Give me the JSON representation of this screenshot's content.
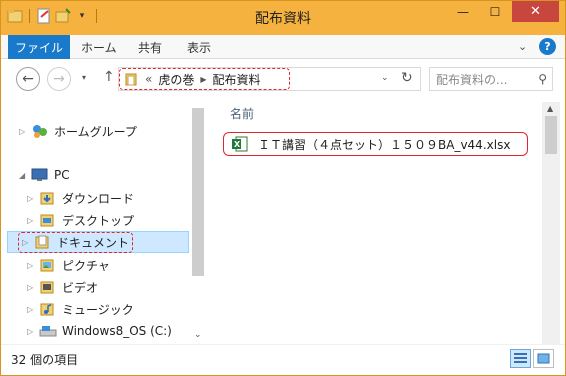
{
  "window": {
    "title": "配布資料"
  },
  "ribbon": {
    "file_tab": "ファイル",
    "tabs": [
      "ホーム",
      "共有",
      "表示"
    ],
    "help_label": "?"
  },
  "address": {
    "prefix": "«",
    "crumbs": [
      "虎の巻",
      "配布資料"
    ],
    "search_placeholder": "配布資料の..."
  },
  "nav": {
    "homegroup": "ホームグループ",
    "pc": "PC",
    "items": [
      "ダウンロード",
      "デスクトップ",
      "ドキュメント",
      "ピクチャ",
      "ビデオ",
      "ミュージック",
      "Windows8_OS (C:)"
    ],
    "selected_item": "ドキュメント"
  },
  "files": {
    "column_name": "名前",
    "items": [
      {
        "name": "ＩＴ講習（４点セット）１５０９BA_v44.xlsx",
        "type": "excel"
      }
    ]
  },
  "status": {
    "count_text": "32 個の項目"
  },
  "colors": {
    "titlebar": "#f6b23e",
    "accent": "#1979ca",
    "close": "#c7463e",
    "highlight": "#e0252b",
    "selection": "#cde8ff"
  }
}
